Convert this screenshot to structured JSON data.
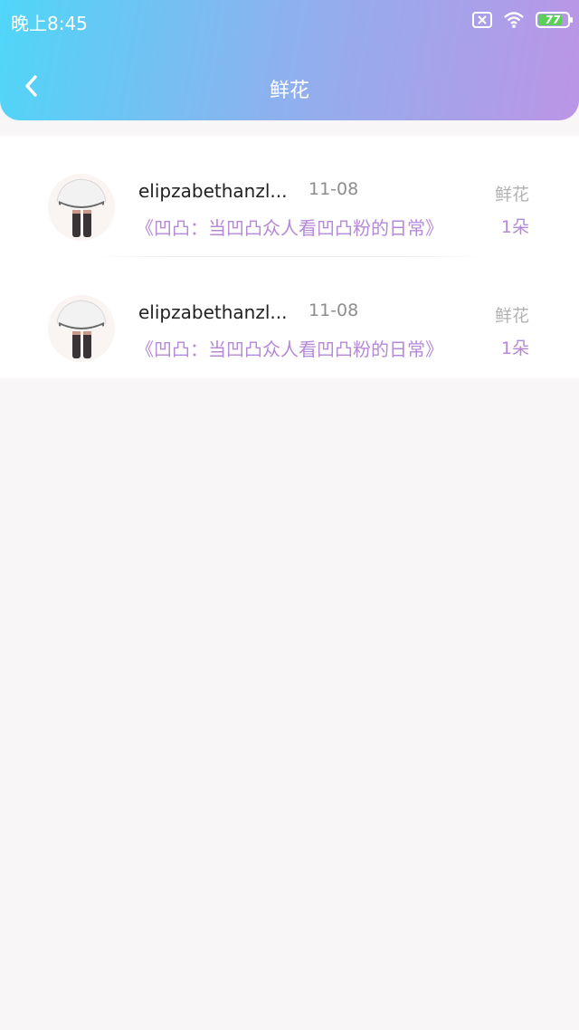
{
  "status_bar": {
    "time": "晚上8:45",
    "battery": "77",
    "icons": [
      "sim-x-icon",
      "wifi-icon",
      "battery-icon"
    ]
  },
  "header": {
    "title": "鲜花",
    "back_icon": "chevron-left-icon"
  },
  "list": {
    "items": [
      {
        "username": "elipzabethanzl...",
        "date": "11-08",
        "type": "鲜花",
        "work_title": "《凹凸：当凹凸众人看凹凸粉的日常》",
        "count": "1朵"
      },
      {
        "username": "elipzabethanzl...",
        "date": "11-08",
        "type": "鲜花",
        "work_title": "《凹凸：当凹凸众人看凹凸粉的日常》",
        "count": "1朵"
      }
    ]
  },
  "colors": {
    "header_gradient_start": "#4fd6f8",
    "header_gradient_end": "#bb95e6",
    "accent": "#b688d8",
    "background": "#f8f6f7"
  }
}
